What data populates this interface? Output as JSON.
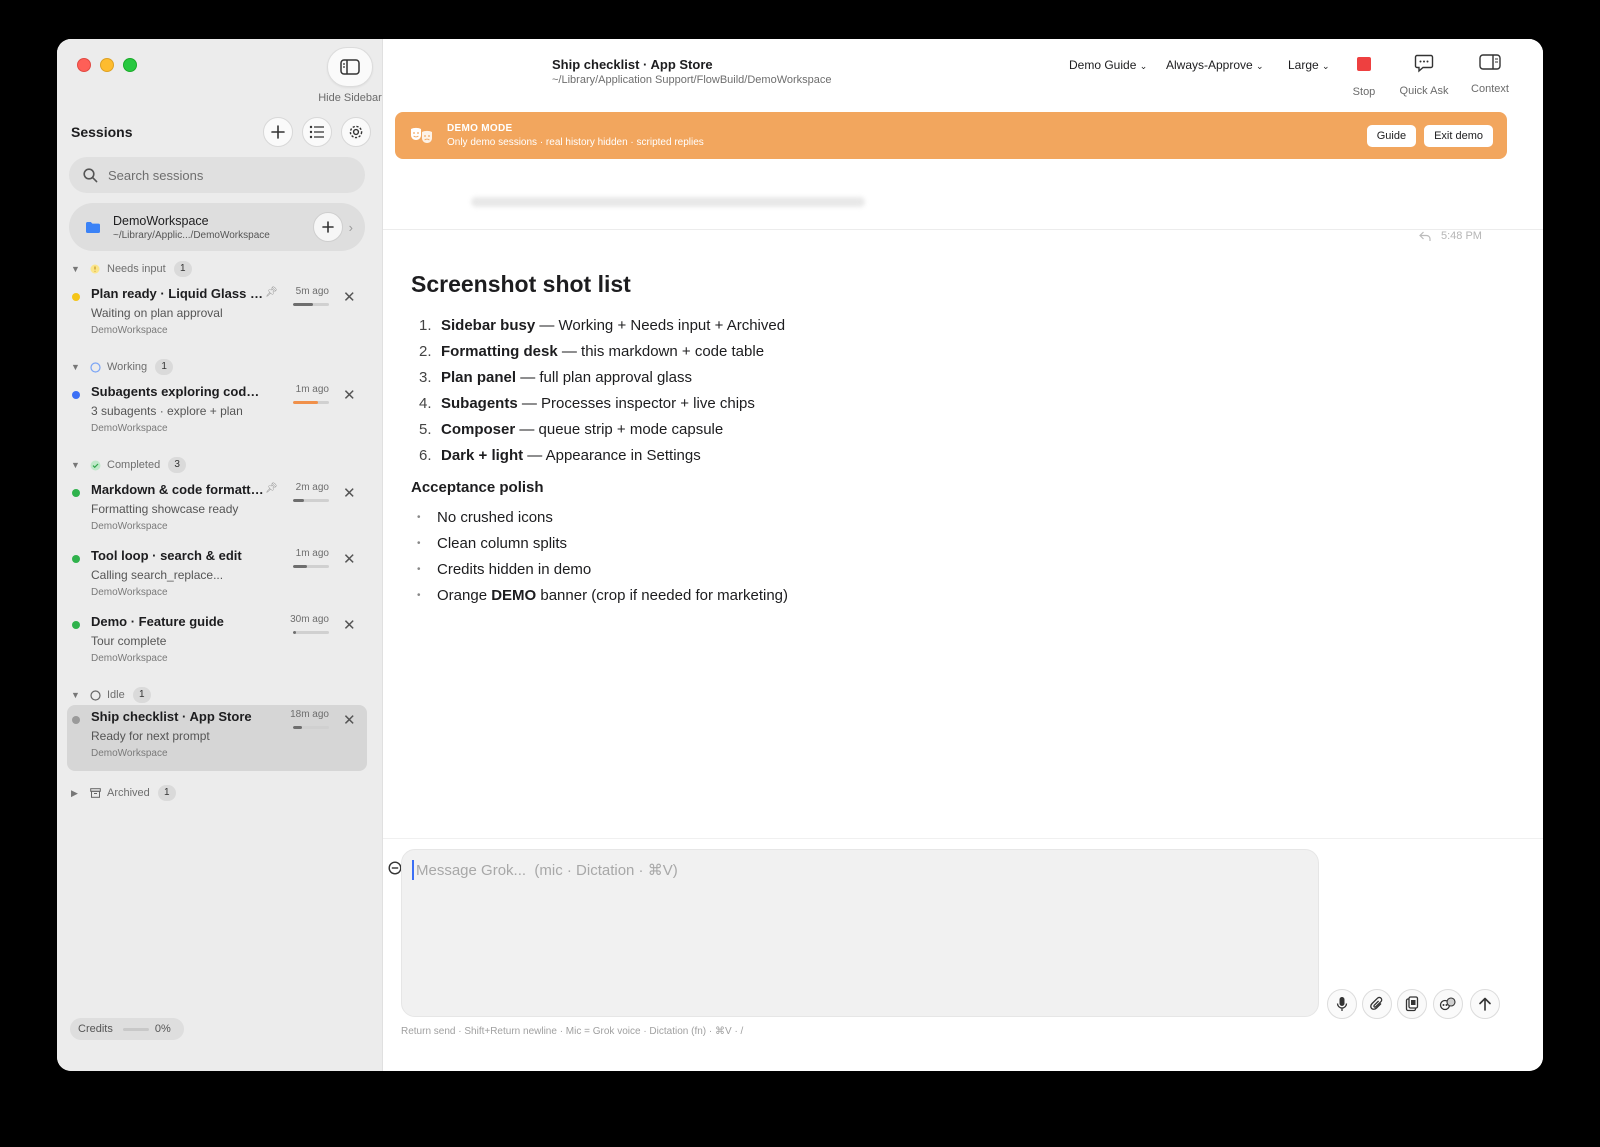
{
  "window": {
    "title": "Ship checklist · App Store",
    "path": "~/Library/Application Support/FlowBuild/DemoWorkspace"
  },
  "sidebar": {
    "hide_label": "Hide Sidebar",
    "sessions_title": "Sessions",
    "search_placeholder": "Search sessions",
    "workspace": {
      "name": "DemoWorkspace",
      "path": "~/Library/Applic.../DemoWorkspace"
    },
    "groups": {
      "needs_input": {
        "label": "Needs input",
        "count": "1"
      },
      "working": {
        "label": "Working",
        "count": "1"
      },
      "completed": {
        "label": "Completed",
        "count": "3"
      },
      "idle": {
        "label": "Idle",
        "count": "1"
      },
      "archived": {
        "label": "Archived",
        "count": "1"
      }
    },
    "sessions": [
      {
        "title": "Plan ready · Liquid Glass panel",
        "subtitle": "Waiting on plan approval",
        "workspace": "DemoWorkspace",
        "time": "5m ago",
        "progress": 0.55,
        "status_color": "#f5c518",
        "bar_color": "#6e6e6e",
        "pinned": true
      },
      {
        "title": "Subagents exploring codebase",
        "subtitle": "3 subagents · explore + plan",
        "workspace": "DemoWorkspace",
        "time": "1m ago",
        "progress": 0.7,
        "status_color": "#3b6ff5",
        "bar_color": "#f0904a",
        "pinned": false
      },
      {
        "title": "Markdown & code formatting",
        "subtitle": "Formatting showcase ready",
        "workspace": "DemoWorkspace",
        "time": "2m ago",
        "progress": 0.3,
        "status_color": "#2fb24c",
        "bar_color": "#6e6e6e",
        "pinned": true
      },
      {
        "title": "Tool loop · search & edit",
        "subtitle": "Calling search_replace...",
        "workspace": "DemoWorkspace",
        "time": "1m ago",
        "progress": 0.4,
        "status_color": "#2fb24c",
        "bar_color": "#6e6e6e",
        "pinned": false
      },
      {
        "title": "Demo · Feature guide",
        "subtitle": "Tour complete",
        "workspace": "DemoWorkspace",
        "time": "30m ago",
        "progress": 0.08,
        "status_color": "#2fb24c",
        "bar_color": "#6e6e6e",
        "pinned": false
      },
      {
        "title": "Ship checklist · App Store",
        "subtitle": "Ready for next prompt",
        "workspace": "DemoWorkspace",
        "time": "18m ago",
        "progress": 0.25,
        "status_color": "#9a9a9a",
        "bar_color": "#6e6e6e",
        "pinned": false
      }
    ],
    "credits": {
      "label": "Credits",
      "value": "0%",
      "progress": 0
    }
  },
  "toolbar": {
    "guide_dropdown": "Demo Guide",
    "approval_dropdown": "Always-Approve",
    "size_dropdown": "Large",
    "stop_label": "Stop",
    "quick_ask_label": "Quick Ask",
    "context_label": "Context"
  },
  "banner": {
    "title": "DEMO MODE",
    "subtitle": "Only demo sessions · real history hidden · scripted replies",
    "guide_btn": "Guide",
    "exit_btn": "Exit demo"
  },
  "message": {
    "time": "5:48 PM"
  },
  "doc": {
    "heading": "Screenshot shot list",
    "list": [
      {
        "num": "1.",
        "bold": "Sidebar busy",
        "rest": " — Working + Needs input + Archived"
      },
      {
        "num": "2.",
        "bold": "Formatting desk",
        "rest": " — this markdown + code table"
      },
      {
        "num": "3.",
        "bold": "Plan panel",
        "rest": " — full plan approval glass"
      },
      {
        "num": "4.",
        "bold": "Subagents",
        "rest": " — Processes inspector + live chips"
      },
      {
        "num": "5.",
        "bold": "Composer",
        "rest": " — queue strip + mode capsule"
      },
      {
        "num": "6.",
        "bold": "Dark + light",
        "rest": " — Appearance in Settings"
      }
    ],
    "subheading": "Acceptance polish",
    "bullets": [
      {
        "pre": "No crushed icons",
        "bold": "",
        "post": ""
      },
      {
        "pre": "Clean column splits",
        "bold": "",
        "post": ""
      },
      {
        "pre": "Credits hidden in demo",
        "bold": "",
        "post": ""
      },
      {
        "pre": "Orange ",
        "bold": "DEMO",
        "post": " banner (crop if needed for marketing)"
      }
    ]
  },
  "composer": {
    "placeholder": "Message Grok...  (mic · Dictation · ⌘V)",
    "hints": "Return send  ·  Shift+Return newline  ·  Mic = Grok voice  ·  Dictation (fn)  ·  ⌘V  ·  /"
  }
}
